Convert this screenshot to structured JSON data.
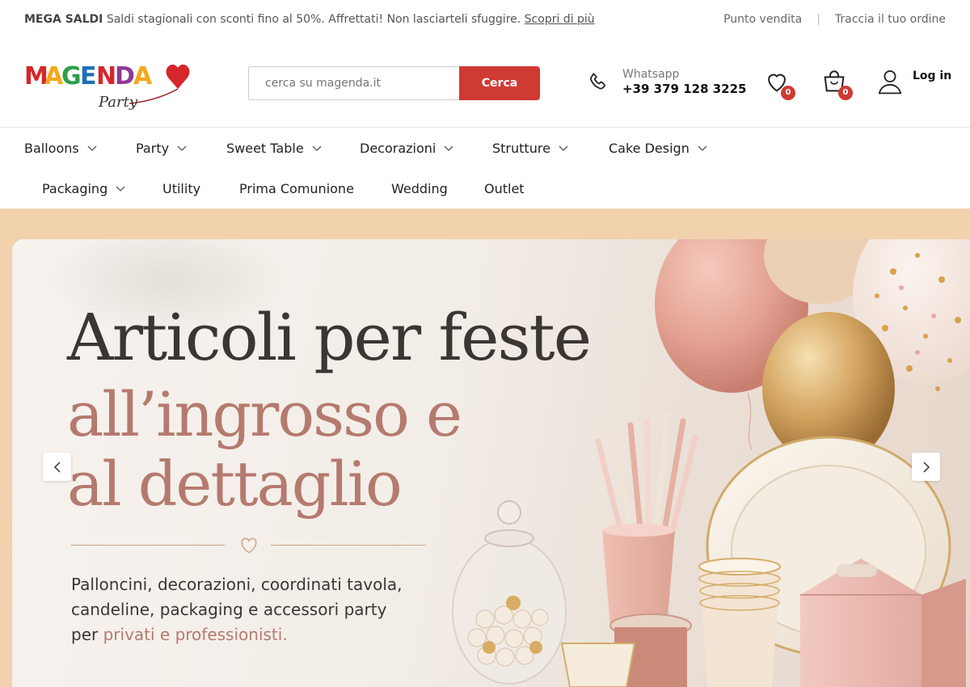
{
  "topbar": {
    "promo_bold": "MEGA SALDI",
    "promo_text": " Saldi stagionali con sconti fino al 50%. Affrettati! Non lasciarteli sfuggire. ",
    "promo_link": "Scopri di più",
    "links": [
      "Punto vendita",
      "Traccia il tuo ordine"
    ]
  },
  "header": {
    "logo_text": "MAGENDA",
    "logo_sub": "Party",
    "search_placeholder": "cerca su magenda.it",
    "search_button": "Cerca",
    "whatsapp_label": "Whatsapp",
    "whatsapp_number": "+39 379 128 3225",
    "wishlist_count": "0",
    "cart_count": "0",
    "login_label": "Log in"
  },
  "nav": {
    "row1": [
      "Balloons",
      "Party",
      "Sweet Table",
      "Decorazioni",
      "Strutture",
      "Cake Design"
    ],
    "row2": [
      "Packaging",
      "Utility",
      "Prima Comunione",
      "Wedding",
      "Outlet"
    ]
  },
  "hero": {
    "line1": "Articoli per feste",
    "line2": "all’ingrosso e",
    "line3": "al dettaglio",
    "sub1": "Palloncini, decorazioni, coordinati tavola,",
    "sub2": "candeline, packaging e accessori party",
    "sub3_pre": "per ",
    "sub3_hl": "privati e professionisti."
  },
  "colors": {
    "accent": "#cf3a33",
    "hero_frame": "#f1d2ad",
    "rose_text": "#b57a6f"
  },
  "icons": [
    "phone-icon",
    "heart-icon",
    "bag-icon",
    "user-icon",
    "chevron-down-icon",
    "chevron-left-icon",
    "chevron-right-icon"
  ]
}
